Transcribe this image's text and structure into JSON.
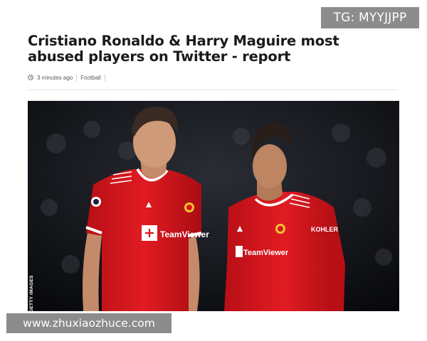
{
  "watermark_top": "TG: MYYJJPP",
  "watermark_bottom": "www.zhuxiaozhuce.com",
  "article": {
    "headline": "Cristiano Ronaldo & Harry Maguire most abused players on Twitter - report",
    "meta": {
      "time": "3 minutes ago",
      "category": "Football",
      "clock_icon": "clock-icon"
    },
    "photo": {
      "credit": "GETTY IMAGES",
      "kit_sponsor": "TeamViewer",
      "sleeve_sponsor": "KOHLER"
    }
  },
  "colors": {
    "kit_red": "#d8161c",
    "headline": "#1a1a1a",
    "meta_text": "#5a5a5a",
    "watermark_bg": "#8c8c8c"
  }
}
